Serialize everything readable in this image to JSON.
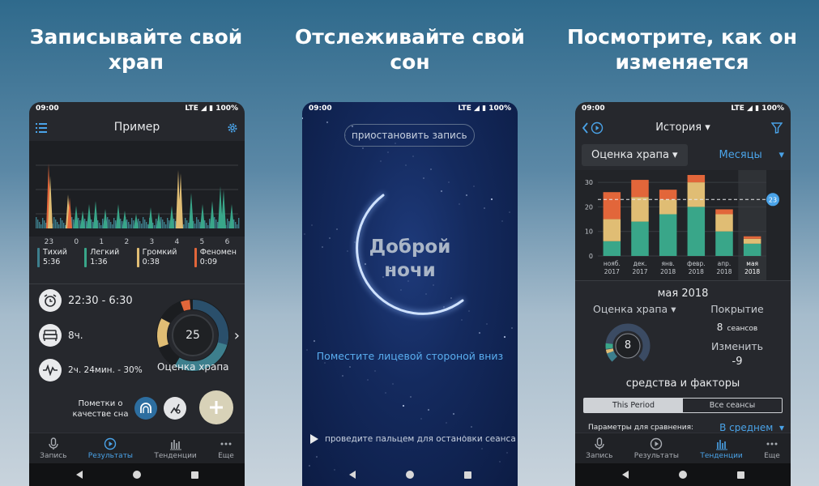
{
  "headlines": [
    "Записывайте свой храп",
    "Отслеживайте свой сон",
    "Посмотрите, как он изменяется"
  ],
  "status": {
    "time": "09:00",
    "network": "LTE",
    "battery": "100%"
  },
  "phone1": {
    "title": "Пример",
    "chart_data": {
      "type": "bar",
      "x_ticks": [
        "23",
        "0",
        "1",
        "2",
        "3",
        "4",
        "5",
        "6"
      ],
      "series_legend": [
        "Тихий",
        "Легкий",
        "Громкий",
        "Феномен"
      ]
    },
    "legend": [
      {
        "name": "Тихий",
        "value": "5:36",
        "color": "#3d7f8d"
      },
      {
        "name": "Легкий",
        "value": "1:36",
        "color": "#39a689"
      },
      {
        "name": "Громкий",
        "value": "0:38",
        "color": "#e0bd74"
      },
      {
        "name": "Феномен",
        "value": "0:09",
        "color": "#e2663a"
      }
    ],
    "time_range": "22:30 - 6:30",
    "duration": "8ч.",
    "snore_stat": "2ч. 24мин. - 30%",
    "score": "25",
    "score_label": "Оценка храпа",
    "notes_label": "Пометки о качестве сна",
    "tabs": [
      "Запись",
      "Результаты",
      "Тенденции",
      "Еще"
    ],
    "active_tab": "Результаты"
  },
  "phone2": {
    "pause_button": "приостановить запись",
    "greeting_line1": "Доброй",
    "greeting_line2": "ночи",
    "instruction": "Поместите лицевой стороной вниз",
    "swipe_hint": "проведите пальцем для остановки сеанса"
  },
  "phone3": {
    "title": "История",
    "metric_select": "Оценка храпа",
    "period_select": "Месяцы",
    "chart_data": {
      "type": "bar",
      "stacked": true,
      "categories": [
        "нояб. 2017",
        "дек. 2017",
        "янв. 2018",
        "февр. 2018",
        "апр. 2018",
        "мая 2018"
      ],
      "yticks": [
        0,
        10,
        20,
        30
      ],
      "ylim": [
        0,
        33
      ],
      "average_line": 23,
      "average_label": "23",
      "series": [
        {
          "color": "#39a689",
          "values": [
            6,
            14,
            17,
            20,
            10,
            5
          ]
        },
        {
          "color": "#e0bd74",
          "values": [
            9,
            10,
            6,
            10,
            7,
            2
          ]
        },
        {
          "color": "#e2663a",
          "values": [
            11,
            7,
            4,
            3,
            2,
            1
          ]
        }
      ]
    },
    "x_labels": [
      [
        "нояб.",
        "2017"
      ],
      [
        "дек.",
        "2017"
      ],
      [
        "янв.",
        "2018"
      ],
      [
        "февр.",
        "2018"
      ],
      [
        "апр.",
        "2018"
      ],
      [
        "мая",
        "2018"
      ]
    ],
    "period_title": "мая 2018",
    "score_label": "Оценка храпа",
    "score": "8",
    "coverage_label": "Покрытие",
    "coverage_value": "8",
    "coverage_unit": "сеансов",
    "change_label": "Изменить",
    "change_value": "-9",
    "factors_title": "средства и факторы",
    "segment_active": "This Period",
    "segment_other": "Все сеансы",
    "compare_label": "Параметры для сравнения:",
    "compare_value": "В среднем",
    "tabs": [
      "Запись",
      "Результаты",
      "Тенденции",
      "Еще"
    ],
    "active_tab": "Тенденции"
  }
}
